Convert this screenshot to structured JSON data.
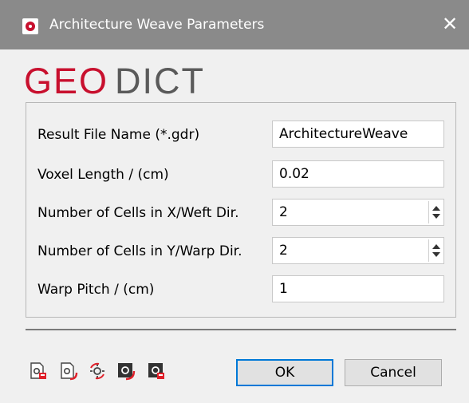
{
  "window": {
    "title": "Architecture Weave Parameters",
    "close_glyph": "✕"
  },
  "logo": {
    "part1": "GEO",
    "part2": "DICT",
    "accent_color": "#c8102e",
    "secondary_color": "#5a5a5a"
  },
  "form": {
    "rows": [
      {
        "label": "Result File Name (*.gdr)",
        "value": "ArchitectureWeave",
        "type": "text"
      },
      {
        "label": "Voxel Length / (cm)",
        "value": "0.02",
        "type": "text"
      },
      {
        "label": "Number of Cells in X/Weft Dir.",
        "value": "2",
        "type": "spinbox"
      },
      {
        "label": "Number of Cells in Y/Warp Dir.",
        "value": "2",
        "type": "spinbox"
      },
      {
        "label": "Warp Pitch / (cm)",
        "value": "1",
        "type": "text"
      }
    ]
  },
  "toolbar": {
    "icons": [
      "load-settings-icon",
      "save-settings-icon",
      "reset-settings-icon",
      "run-macro-icon",
      "record-macro-icon"
    ]
  },
  "buttons": {
    "ok": "OK",
    "cancel": "Cancel"
  },
  "colors": {
    "titlebar": "#8a8a8a",
    "focus_border": "#0078d7",
    "icon_red": "#e0202a"
  }
}
